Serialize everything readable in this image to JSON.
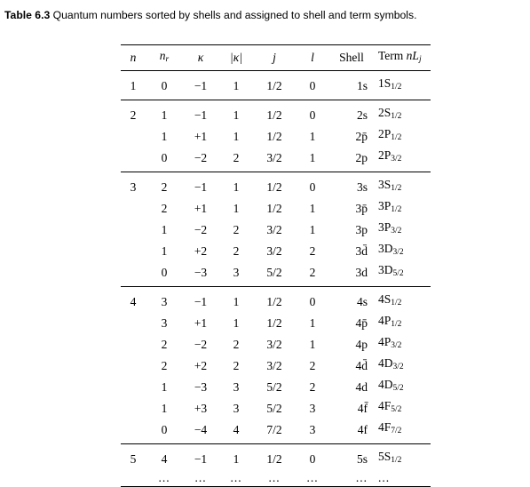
{
  "caption": {
    "label": "Table 6.3",
    "text": "Quantum numbers sorted by shells and assigned to shell and term symbols."
  },
  "headers": {
    "n": "n",
    "nr": "n",
    "nr_sub": "r",
    "kappa": "κ",
    "abs_kappa": "|κ|",
    "j": "j",
    "l": "l",
    "shell": "Shell",
    "term_prefix": "Term ",
    "term_sym": "nL",
    "term_sub": "j"
  },
  "groups": [
    {
      "n": "1",
      "rows": [
        {
          "nr": "0",
          "kappa": "−1",
          "ak": "1",
          "j": "1/2",
          "l": "0",
          "shell": "1s",
          "term": "1S",
          "term_sub": "1/2"
        }
      ]
    },
    {
      "n": "2",
      "rows": [
        {
          "nr": "1",
          "kappa": "−1",
          "ak": "1",
          "j": "1/2",
          "l": "0",
          "shell": "2s",
          "term": "2S",
          "term_sub": "1/2"
        },
        {
          "nr": "1",
          "kappa": "+1",
          "ak": "1",
          "j": "1/2",
          "l": "1",
          "shell": "2p̄",
          "term": "2P",
          "term_sub": "1/2"
        },
        {
          "nr": "0",
          "kappa": "−2",
          "ak": "2",
          "j": "3/2",
          "l": "1",
          "shell": "2p",
          "term": "2P",
          "term_sub": "3/2"
        }
      ]
    },
    {
      "n": "3",
      "rows": [
        {
          "nr": "2",
          "kappa": "−1",
          "ak": "1",
          "j": "1/2",
          "l": "0",
          "shell": "3s",
          "term": "3S",
          "term_sub": "1/2"
        },
        {
          "nr": "2",
          "kappa": "+1",
          "ak": "1",
          "j": "1/2",
          "l": "1",
          "shell": "3p̄",
          "term": "3P",
          "term_sub": "1/2"
        },
        {
          "nr": "1",
          "kappa": "−2",
          "ak": "2",
          "j": "3/2",
          "l": "1",
          "shell": "3p",
          "term": "3P",
          "term_sub": "3/2"
        },
        {
          "nr": "1",
          "kappa": "+2",
          "ak": "2",
          "j": "3/2",
          "l": "2",
          "shell": "3d̄",
          "term": "3D",
          "term_sub": "3/2"
        },
        {
          "nr": "0",
          "kappa": "−3",
          "ak": "3",
          "j": "5/2",
          "l": "2",
          "shell": "3d",
          "term": "3D",
          "term_sub": "5/2"
        }
      ]
    },
    {
      "n": "4",
      "rows": [
        {
          "nr": "3",
          "kappa": "−1",
          "ak": "1",
          "j": "1/2",
          "l": "0",
          "shell": "4s",
          "term": "4S",
          "term_sub": "1/2"
        },
        {
          "nr": "3",
          "kappa": "+1",
          "ak": "1",
          "j": "1/2",
          "l": "1",
          "shell": "4p̄",
          "term": "4P",
          "term_sub": "1/2"
        },
        {
          "nr": "2",
          "kappa": "−2",
          "ak": "2",
          "j": "3/2",
          "l": "1",
          "shell": "4p",
          "term": "4P",
          "term_sub": "3/2"
        },
        {
          "nr": "2",
          "kappa": "+2",
          "ak": "2",
          "j": "3/2",
          "l": "2",
          "shell": "4d̄",
          "term": "4D",
          "term_sub": "3/2"
        },
        {
          "nr": "1",
          "kappa": "−3",
          "ak": "3",
          "j": "5/2",
          "l": "2",
          "shell": "4d",
          "term": "4D",
          "term_sub": "5/2"
        },
        {
          "nr": "1",
          "kappa": "+3",
          "ak": "3",
          "j": "5/2",
          "l": "3",
          "shell": "4f̄",
          "term": "4F",
          "term_sub": "5/2"
        },
        {
          "nr": "0",
          "kappa": "−4",
          "ak": "4",
          "j": "7/2",
          "l": "3",
          "shell": "4f",
          "term": "4F",
          "term_sub": "7/2"
        }
      ]
    }
  ],
  "last_group": {
    "n": "5",
    "row": {
      "nr": "4",
      "kappa": "−1",
      "ak": "1",
      "j": "1/2",
      "l": "0",
      "shell": "5s",
      "term": "5S",
      "term_sub": "1/2"
    },
    "ellipsis": "..."
  }
}
